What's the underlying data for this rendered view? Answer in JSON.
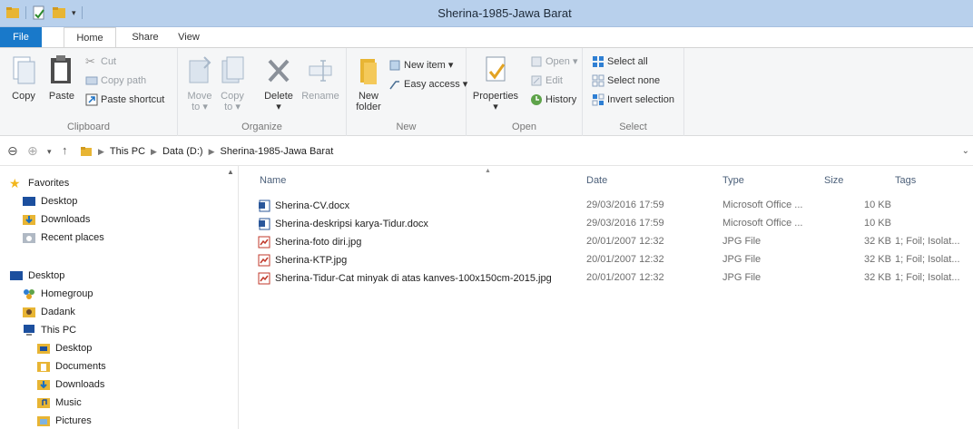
{
  "window": {
    "title": "Sherina-1985-Jawa Barat"
  },
  "menu_tabs": {
    "file": "File",
    "home": "Home",
    "share": "Share",
    "view": "View"
  },
  "ribbon": {
    "clipboard": {
      "label": "Clipboard",
      "copy": "Copy",
      "paste": "Paste",
      "cut": "Cut",
      "copy_path": "Copy path",
      "paste_shortcut": "Paste shortcut"
    },
    "organize": {
      "label": "Organize",
      "move_to": "Move",
      "move_to_2": "to ▾",
      "copy_to": "Copy",
      "copy_to_2": "to ▾",
      "delete": "Delete",
      "delete_2": "▾",
      "rename": "Rename"
    },
    "new": {
      "label": "New",
      "new_folder": "New",
      "new_folder_2": "folder",
      "new_item": "New item ▾",
      "easy_access": "Easy access ▾"
    },
    "open": {
      "label": "Open",
      "properties": "Properties",
      "properties_2": "▾",
      "open": "Open ▾",
      "edit": "Edit",
      "history": "History"
    },
    "select": {
      "label": "Select",
      "select_all": "Select all",
      "select_none": "Select none",
      "invert_selection": "Invert selection"
    }
  },
  "address": {
    "crumbs": [
      "This PC",
      "Data (D:)",
      "Sherina-1985-Jawa Barat"
    ]
  },
  "nav": {
    "favorites": "Favorites",
    "fav_items": [
      "Desktop",
      "Downloads",
      "Recent places"
    ],
    "desktop": "Desktop",
    "homegroup": "Homegroup",
    "dadank": "Dadank",
    "this_pc": "This PC",
    "pc_items": [
      "Desktop",
      "Documents",
      "Downloads",
      "Music",
      "Pictures"
    ]
  },
  "columns": {
    "name": "Name",
    "date": "Date",
    "type": "Type",
    "size": "Size",
    "tags": "Tags"
  },
  "files": [
    {
      "name": "Sherina-CV.docx",
      "date": "29/03/2016 17:59",
      "type": "Microsoft Office ...",
      "size": "10 KB",
      "tags": "",
      "kind": "docx-icon"
    },
    {
      "name": "Sherina-deskripsi karya-Tidur.docx",
      "date": "29/03/2016 17:59",
      "type": "Microsoft Office ...",
      "size": "10 KB",
      "tags": "",
      "kind": "docx-icon"
    },
    {
      "name": "Sherina-foto diri.jpg",
      "date": "20/01/2007 12:32",
      "type": "JPG File",
      "size": "32 KB",
      "tags": "1; Foil; Isolat...",
      "kind": "jpg-icon"
    },
    {
      "name": "Sherina-KTP.jpg",
      "date": "20/01/2007 12:32",
      "type": "JPG File",
      "size": "32 KB",
      "tags": "1; Foil; Isolat...",
      "kind": "jpg-icon"
    },
    {
      "name": "Sherina-Tidur-Cat minyak di atas kanves-100x150cm-2015.jpg",
      "date": "20/01/2007 12:32",
      "type": "JPG File",
      "size": "32 KB",
      "tags": "1; Foil; Isolat...",
      "kind": "jpg-icon"
    }
  ],
  "colors": {
    "accent": "#1979ca",
    "titlebar": "#b8d0ec",
    "folder": "#e8b534"
  }
}
